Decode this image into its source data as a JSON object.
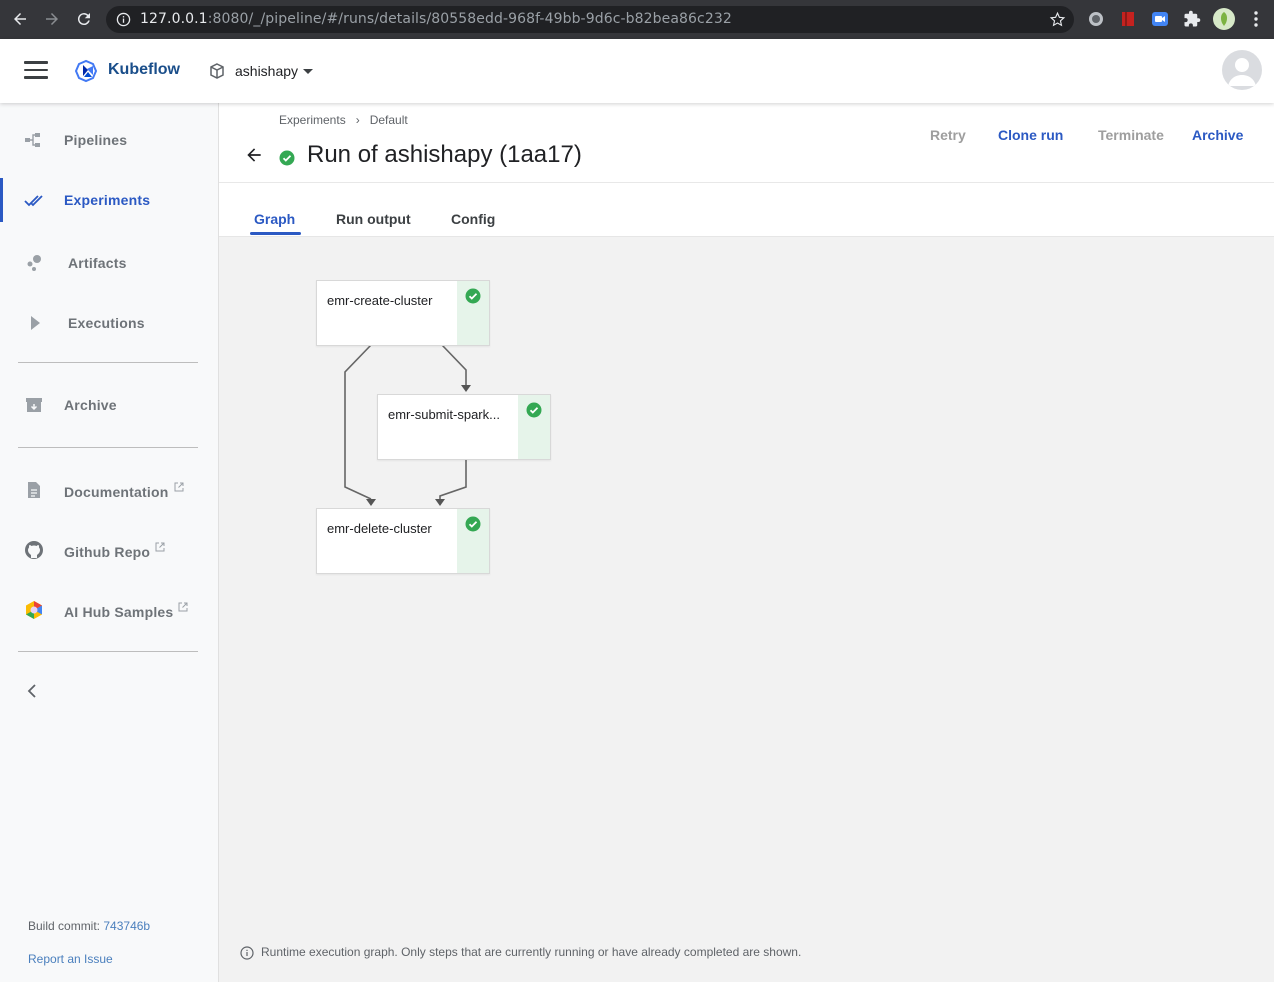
{
  "browser": {
    "url_host": "127.0.0.1",
    "url_rest": ":8080/_/pipeline/#/runs/details/80558edd-968f-49bb-9d6c-b82bea86c232"
  },
  "header": {
    "app_title": "Kubeflow",
    "namespace": "ashishapy"
  },
  "sidebar": {
    "items": [
      {
        "label": "Pipelines",
        "icon": "pipelines-icon"
      },
      {
        "label": "Experiments",
        "icon": "experiments-icon"
      },
      {
        "label": "Artifacts",
        "icon": "artifacts-icon"
      },
      {
        "label": "Executions",
        "icon": "play-icon"
      },
      {
        "label": "Archive",
        "icon": "archive-icon"
      },
      {
        "label": "Documentation",
        "icon": "document-icon"
      },
      {
        "label": "Github Repo",
        "icon": "github-icon"
      },
      {
        "label": "AI Hub Samples",
        "icon": "ai-hub-icon"
      }
    ],
    "build_label": "Build commit:",
    "build_commit": "743746b",
    "report_issue": "Report an Issue"
  },
  "page": {
    "breadcrumbs": [
      "Experiments",
      "Default"
    ],
    "breadcrumb_sep": "›",
    "title": "Run of ashishapy (1aa17)",
    "actions": {
      "retry": "Retry",
      "clone": "Clone run",
      "terminate": "Terminate",
      "archive": "Archive"
    },
    "tabs": [
      "Graph",
      "Run output",
      "Config"
    ],
    "active_tab": "Graph"
  },
  "graph": {
    "nodes": [
      {
        "label": "emr-create-cluster",
        "status": "succeeded"
      },
      {
        "label": "emr-submit-spark...",
        "status": "succeeded"
      },
      {
        "label": "emr-delete-cluster",
        "status": "succeeded"
      }
    ],
    "footnote": "Runtime execution graph. Only steps that are currently running or have already completed are shown."
  },
  "colors": {
    "accent": "#2b59c3",
    "success": "#34a853",
    "success_bg": "#e6f4ea"
  }
}
